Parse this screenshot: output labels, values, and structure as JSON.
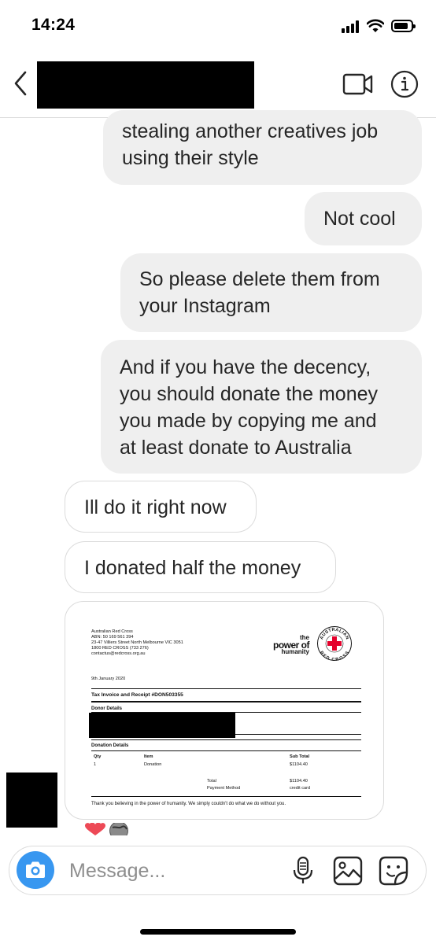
{
  "status_bar": {
    "time": "14:24",
    "icons": [
      "signal-icon",
      "wifi-icon",
      "battery-icon"
    ]
  },
  "header": {
    "back_icon": "chevron-left-icon",
    "video_icon": "video-call-icon",
    "info_icon": "info-icon"
  },
  "messages": [
    {
      "from": "me",
      "text_lines": [
        "stealing another creatives job",
        "using their style"
      ]
    },
    {
      "from": "me",
      "text": "Not cool"
    },
    {
      "from": "me",
      "text_lines": [
        "So please delete them from",
        "your Instagram"
      ]
    },
    {
      "from": "me",
      "text_lines": [
        "And if you have the decency,",
        "you should donate the money",
        "you made by copying me and",
        "at least donate to Australia"
      ]
    },
    {
      "from": "them",
      "text": "Ill do it right now"
    },
    {
      "from": "them",
      "text": "I donated half the money"
    }
  ],
  "receipt": {
    "address_lines": [
      "Australian Red Cross",
      "ABN: 50 169 561 394",
      "23-47 Villiers Street North Melbourne VIC 3051",
      "1800 RED CROSS (733 276)",
      "contactus@redcross.org.au"
    ],
    "logo_lines": [
      "the",
      "power of",
      "humanity"
    ],
    "emblem_top": "AUSTRALIAN",
    "emblem_bottom": "RED CROSS",
    "date": "9th January 2020",
    "invoice_title": "Tax Invoice and Receipt #DON503355",
    "donor_details": "Donor Details",
    "donation_details": "Donation Details",
    "columns": {
      "qty": "Qty",
      "item": "Item",
      "subtotal": "Sub Total"
    },
    "row": {
      "qty": "1",
      "item": "Donation",
      "subtotal": "$1104.40"
    },
    "total_label": "Total",
    "total_value": "$1104.40",
    "payment_label": "Payment Method",
    "payment_value": "credit card",
    "thanks": "Thank you believing in the power of humanity. We simply couldn't do what we do without you."
  },
  "reactions": [
    "heart-emoji",
    "globe-emoji"
  ],
  "composer": {
    "placeholder": "Message...",
    "camera_icon": "camera-icon",
    "mic_icon": "microphone-icon",
    "gallery_icon": "gallery-icon",
    "sticker_icon": "sticker-icon"
  },
  "colors": {
    "sent_bubble": "#efefef",
    "received_border": "#dbdbdb",
    "accent": "#3897f0",
    "red_cross": "#e4002b"
  }
}
